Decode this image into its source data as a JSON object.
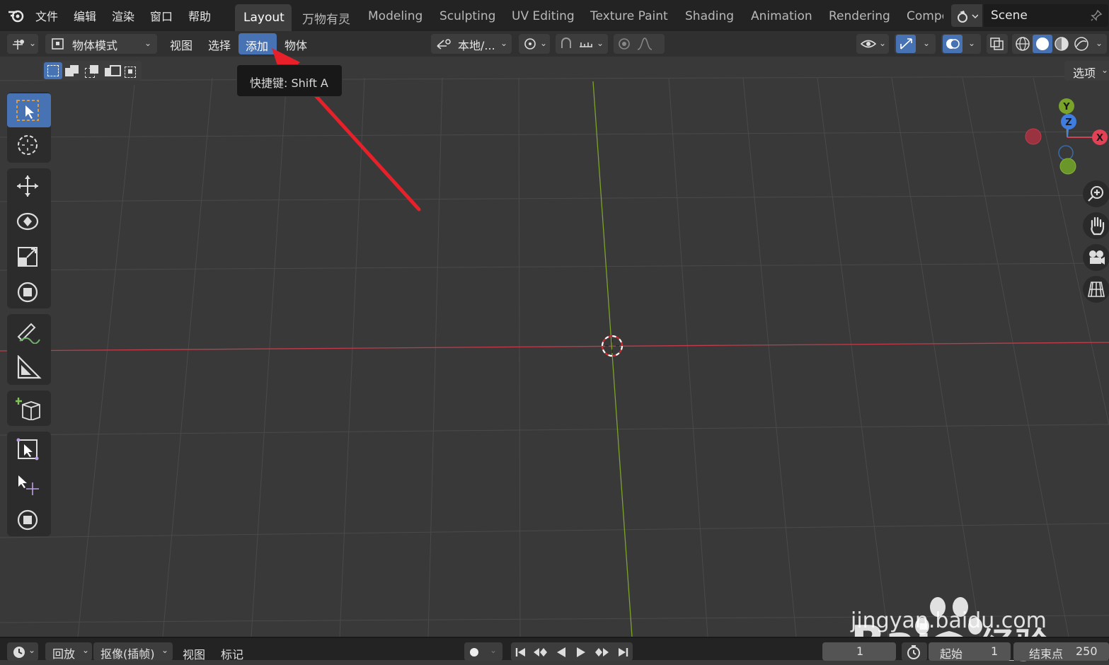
{
  "menubar": {
    "items": [
      "文件",
      "编辑",
      "渲染",
      "窗口",
      "帮助"
    ]
  },
  "workspaces": {
    "active": "Layout",
    "tabs": [
      "万物有灵",
      "Modeling",
      "Sculpting",
      "UV Editing",
      "Texture Paint",
      "Shading",
      "Animation",
      "Rendering",
      "Compc"
    ]
  },
  "scene": {
    "name": "Scene"
  },
  "header": {
    "mode": "物体模式",
    "view": "视图",
    "select": "选择",
    "add": "添加",
    "object": "物体",
    "transform_orientation": "本地/...",
    "options": "选项"
  },
  "tooltip": {
    "text": "快捷键: Shift A"
  },
  "gizmo": {
    "x": "X",
    "y": "Y",
    "z": "Z"
  },
  "timeline": {
    "playback": "回放",
    "keying": "抠像(插帧)",
    "view": "视图",
    "marker": "标记",
    "current_frame": "1",
    "start_label": "起始",
    "start": "1",
    "end_label": "结束点",
    "end": "250"
  },
  "watermark": {
    "url": "jingyan.baidu.com",
    "logo_text": "Bai du 经验"
  },
  "colors": {
    "accent": "#4772b3",
    "x_axis": "#c33b4a",
    "y_axis": "#7ca32a",
    "arrow": "#e8202a"
  }
}
